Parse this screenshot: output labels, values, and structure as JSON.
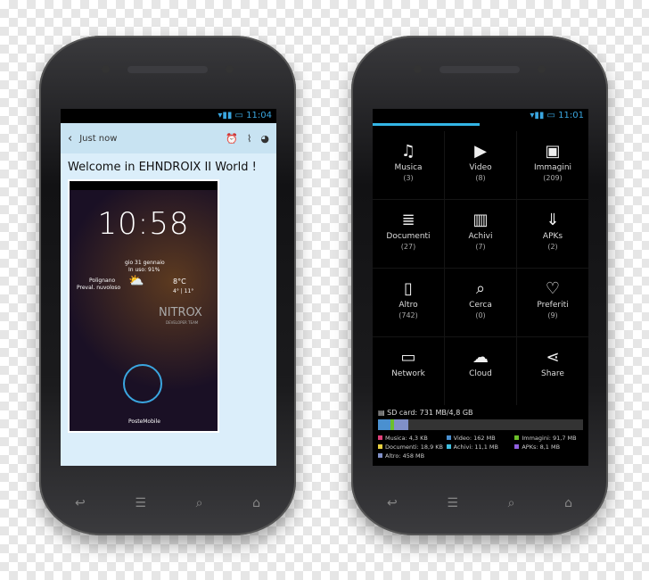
{
  "left_phone": {
    "status_time": "11:04",
    "header": {
      "back_icon": "chevron-left",
      "title": "Just now",
      "icons": [
        "alarm-icon",
        "paperclip-icon",
        "palette-icon"
      ]
    },
    "message_title": "Welcome in EHNDROIX II World !",
    "screenshot": {
      "clock": "10:58",
      "date": "gio 31 gennaio",
      "usage": "In uso: 91%",
      "location": "Polignano",
      "forecast": "Preval. nuvoloso",
      "temp": "8°C",
      "range": "4° | 11°",
      "brand": "NITROX",
      "brand_sub": "DEVELOPER TEAM",
      "carrier": "PosteMobile"
    }
  },
  "right_phone": {
    "status_time": "11:01",
    "progress_color": "#33b5e5",
    "categories": [
      {
        "icon": "♫",
        "label": "Musica",
        "count": "(3)"
      },
      {
        "icon": "▶",
        "label": "Video",
        "count": "(8)"
      },
      {
        "icon": "▣",
        "label": "Immagini",
        "count": "(209)"
      },
      {
        "icon": "≣",
        "label": "Documenti",
        "count": "(27)"
      },
      {
        "icon": "▥",
        "label": "Achivi",
        "count": "(7)"
      },
      {
        "icon": "⇓",
        "label": "APKs",
        "count": "(2)"
      },
      {
        "icon": "▯",
        "label": "Altro",
        "count": "(742)"
      },
      {
        "icon": "⌕",
        "label": "Cerca",
        "count": "(0)"
      },
      {
        "icon": "♡",
        "label": "Preferiti",
        "count": "(9)"
      },
      {
        "icon": "▭",
        "label": "Network",
        "count": ""
      },
      {
        "icon": "☁",
        "label": "Cloud",
        "count": ""
      },
      {
        "icon": "⋖",
        "label": "Share",
        "count": ""
      }
    ],
    "storage": {
      "label": "SD card: 731 MB/4,8 GB",
      "used_fraction": 0.15,
      "legend": [
        {
          "text": "Musica: 4,3 KB",
          "color": "#e0407a"
        },
        {
          "text": "Video: 162 MB",
          "color": "#4a90d0"
        },
        {
          "text": "Immagini: 91,7 MB",
          "color": "#6cbf2a"
        },
        {
          "text": "Documenti: 18,9 KB",
          "color": "#e8d040"
        },
        {
          "text": "Achivi: 11,1 MB",
          "color": "#40c0e0"
        },
        {
          "text": "APKs: 8,1 MB",
          "color": "#9060e0"
        },
        {
          "text": "Altro: 458 MB",
          "color": "#8090c8"
        }
      ]
    }
  },
  "nav": {
    "back": "↩",
    "menu": "☰",
    "search": "⌕",
    "home": "⌂"
  }
}
